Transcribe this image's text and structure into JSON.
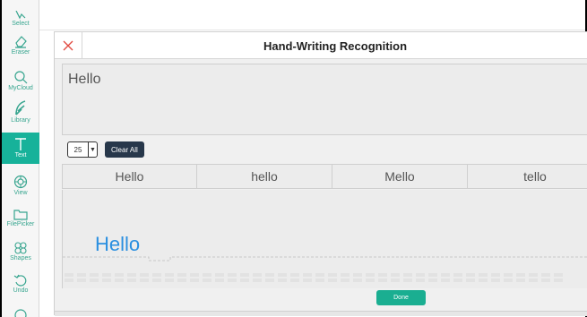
{
  "sidebar": {
    "items": [
      {
        "label": "Select",
        "icon": "select-icon"
      },
      {
        "label": "Eraser",
        "icon": "eraser-icon"
      },
      {
        "label": "MyCloud",
        "icon": "search-icon"
      },
      {
        "label": "Library",
        "icon": "feather-icon"
      },
      {
        "label": "Text",
        "icon": "text-icon",
        "active": true
      },
      {
        "label": "View",
        "icon": "view-icon"
      },
      {
        "label": "FilePicker",
        "icon": "folder-icon"
      },
      {
        "label": "Shapes",
        "icon": "shapes-icon"
      },
      {
        "label": "Undo",
        "icon": "undo-icon"
      }
    ]
  },
  "dialog": {
    "title": "Hand-Writing Recognition",
    "result_text": "Hello",
    "font_size": "25",
    "clear_label": "Clear All",
    "suggestions": [
      "Hello",
      "hello",
      "Mello",
      "tello"
    ],
    "ink_text": "Hello",
    "done_label": "Done"
  },
  "colors": {
    "accent": "#17b29a",
    "ink": "#2a8fe0",
    "close": "#e0483e",
    "dark_button": "#27374a"
  }
}
